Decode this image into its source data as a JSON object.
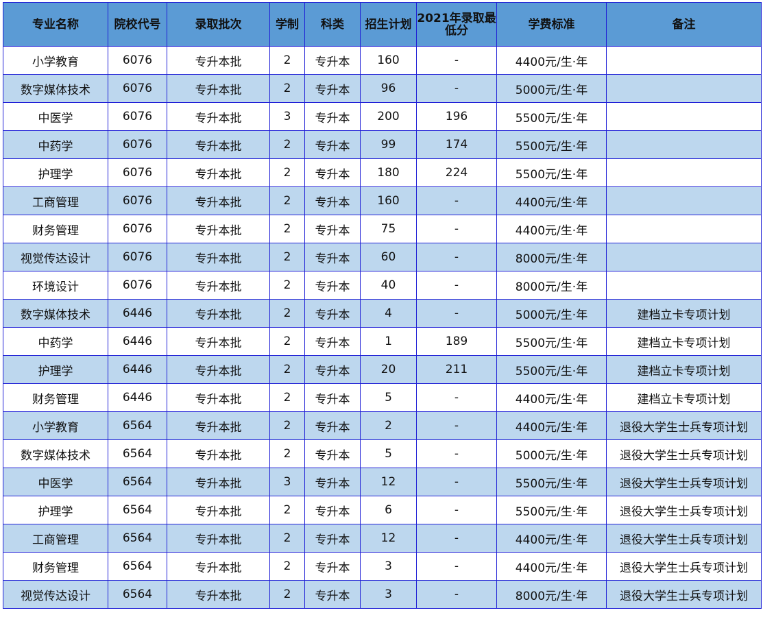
{
  "headers": [
    "专业名称",
    "院校代号",
    "录取批次",
    "学制",
    "科类",
    "招生计划",
    "2021年录取最低分",
    "学费标准",
    "备注"
  ],
  "rows": [
    [
      "小学教育",
      "6076",
      "专升本批",
      "2",
      "专升本",
      "160",
      "-",
      "4400元/生·年",
      ""
    ],
    [
      "数字媒体技术",
      "6076",
      "专升本批",
      "2",
      "专升本",
      "96",
      "-",
      "5000元/生·年",
      ""
    ],
    [
      "中医学",
      "6076",
      "专升本批",
      "3",
      "专升本",
      "200",
      "196",
      "5500元/生·年",
      ""
    ],
    [
      "中药学",
      "6076",
      "专升本批",
      "2",
      "专升本",
      "99",
      "174",
      "5500元/生·年",
      ""
    ],
    [
      "护理学",
      "6076",
      "专升本批",
      "2",
      "专升本",
      "180",
      "224",
      "5500元/生·年",
      ""
    ],
    [
      "工商管理",
      "6076",
      "专升本批",
      "2",
      "专升本",
      "160",
      "-",
      "4400元/生·年",
      ""
    ],
    [
      "财务管理",
      "6076",
      "专升本批",
      "2",
      "专升本",
      "75",
      "-",
      "4400元/生·年",
      ""
    ],
    [
      "视觉传达设计",
      "6076",
      "专升本批",
      "2",
      "专升本",
      "60",
      "-",
      "8000元/生·年",
      ""
    ],
    [
      "环境设计",
      "6076",
      "专升本批",
      "2",
      "专升本",
      "40",
      "-",
      "8000元/生·年",
      ""
    ],
    [
      "数字媒体技术",
      "6446",
      "专升本批",
      "2",
      "专升本",
      "4",
      "-",
      "5000元/生·年",
      "建档立卡专项计划"
    ],
    [
      "中药学",
      "6446",
      "专升本批",
      "2",
      "专升本",
      "1",
      "189",
      "5500元/生·年",
      "建档立卡专项计划"
    ],
    [
      "护理学",
      "6446",
      "专升本批",
      "2",
      "专升本",
      "20",
      "211",
      "5500元/生·年",
      "建档立卡专项计划"
    ],
    [
      "财务管理",
      "6446",
      "专升本批",
      "2",
      "专升本",
      "5",
      "-",
      "4400元/生·年",
      "建档立卡专项计划"
    ],
    [
      "小学教育",
      "6564",
      "专升本批",
      "2",
      "专升本",
      "2",
      "-",
      "4400元/生·年",
      "退役大学生士兵专项计划"
    ],
    [
      "数字媒体技术",
      "6564",
      "专升本批",
      "2",
      "专升本",
      "5",
      "-",
      "5000元/生·年",
      "退役大学生士兵专项计划"
    ],
    [
      "中医学",
      "6564",
      "专升本批",
      "3",
      "专升本",
      "12",
      "-",
      "5500元/生·年",
      "退役大学生士兵专项计划"
    ],
    [
      "护理学",
      "6564",
      "专升本批",
      "2",
      "专升本",
      "6",
      "-",
      "5500元/生·年",
      "退役大学生士兵专项计划"
    ],
    [
      "工商管理",
      "6564",
      "专升本批",
      "2",
      "专升本",
      "12",
      "-",
      "4400元/生·年",
      "退役大学生士兵专项计划"
    ],
    [
      "财务管理",
      "6564",
      "专升本批",
      "2",
      "专升本",
      "3",
      "-",
      "4400元/生·年",
      "退役大学生士兵专项计划"
    ],
    [
      "视觉传达设计",
      "6564",
      "专升本批",
      "2",
      "专升本",
      "3",
      "-",
      "8000元/生·年",
      "退役大学生士兵专项计划"
    ]
  ],
  "colors": {
    "header_bg": "#5b9bd5",
    "stripe_bg": "#bdd7ee",
    "border": "#1f1fd6"
  }
}
